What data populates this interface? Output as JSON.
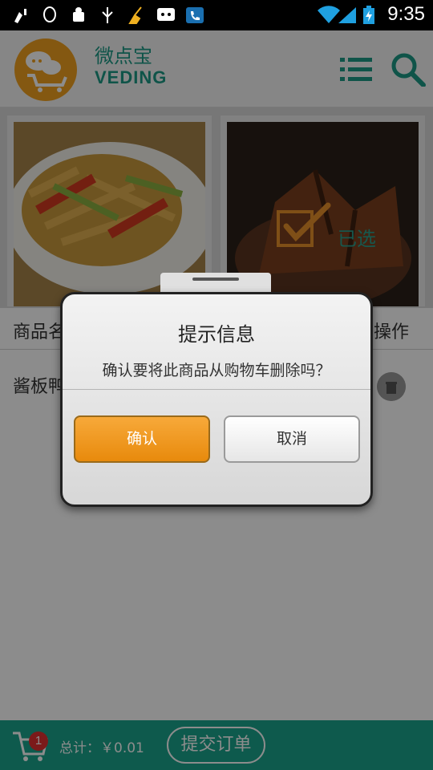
{
  "status_bar": {
    "time": "9:35",
    "icons": [
      "cleaner-icon",
      "qq-icon",
      "android-debug-icon",
      "usb-icon",
      "broom-icon",
      "message-icon",
      "phone-icon",
      "wifi-icon",
      "signal-icon",
      "battery-charging-icon"
    ]
  },
  "header": {
    "app_name": "微点宝",
    "app_sub": "VEDING",
    "logo_icon": "cart-chat-logo",
    "menu_icon": "list-icon",
    "search_icon": "search-icon"
  },
  "products": [
    {
      "image": "stir-fried-dish",
      "selected": false
    },
    {
      "image": "braised-duck",
      "selected": true,
      "selected_label": "已选"
    }
  ],
  "table": {
    "col_name": "商品名",
    "col_op": "操作",
    "rows": [
      {
        "name": "酱板鸭"
      }
    ]
  },
  "bottom_bar": {
    "cart_count": "1",
    "total_text": "总计：￥0.01",
    "submit_label": "提交订单"
  },
  "dialog": {
    "title": "提示信息",
    "message": "确认要将此商品从购物车删除吗？",
    "confirm_label": "确认",
    "cancel_label": "取消"
  },
  "colors": {
    "brand": "#1d9a86",
    "bottom_bar": "#1aa58c",
    "confirm": "#ef9a22",
    "logo": "#f0a020"
  }
}
